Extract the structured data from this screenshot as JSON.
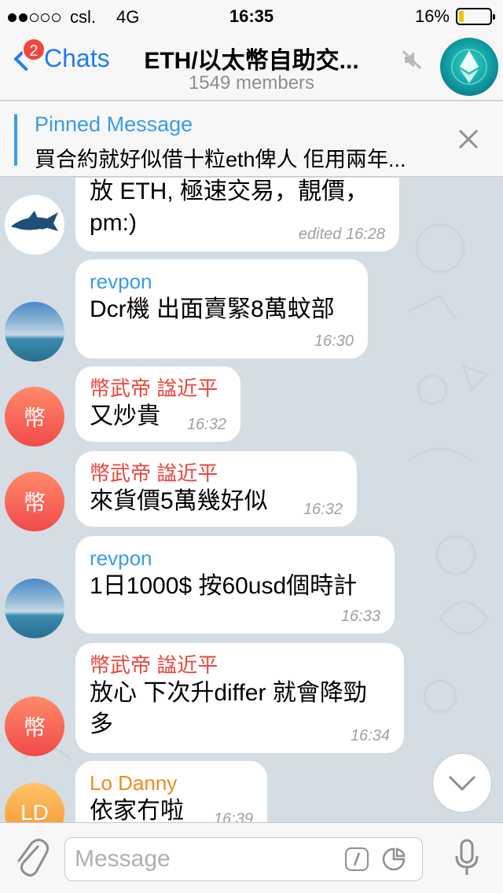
{
  "status": {
    "carrier": "csl.",
    "network": "4G",
    "time": "16:35",
    "battery": "16%",
    "signal_bars": 2,
    "battery_fraction": 0.16
  },
  "nav": {
    "back_label": "Chats",
    "badge": "2",
    "title": "ETH/以太幣自助交...",
    "subtitle": "1549 members",
    "icons": {
      "back": "chevron-left-icon",
      "mute": "muted-speaker-icon"
    }
  },
  "pinned": {
    "title": "Pinned Message",
    "text": "買合約就好似借十粒eth俾人 佢用兩年..."
  },
  "messages": [
    {
      "sender": "",
      "avatar": "",
      "text": "放 ETH, 極速交易，靚價，\npm:)",
      "time": "edited 16:28"
    },
    {
      "sender": "revpon",
      "avatar": "",
      "text": "Dcr機 出面賣緊8萬蚊部",
      "time": "16:30"
    },
    {
      "sender": "幣武帝 諡近平",
      "avatar": "幣",
      "text": "又炒貴",
      "time": "16:32"
    },
    {
      "sender": "幣武帝 諡近平",
      "avatar": "幣",
      "text": "來貨價5萬幾好似",
      "time": "16:32"
    },
    {
      "sender": "revpon",
      "avatar": "",
      "text": "1日1000$ 按60usd個時計",
      "time": "16:33"
    },
    {
      "sender": "幣武帝 諡近平",
      "avatar": "幣",
      "text": "放心 下次升differ 就會降勁\n多",
      "time": "16:34"
    },
    {
      "sender": "Lo Danny",
      "avatar": "LD",
      "text": "依家冇啦",
      "time": "16:39"
    }
  ],
  "input": {
    "placeholder": "Message"
  },
  "colors": {
    "accent": "#1f7df2",
    "pinned_accent": "#3b9be8",
    "badge": "#f2453d",
    "name_red": "#e8463c",
    "name_orange": "#f08a1e",
    "chat_bg": "#d4dde3"
  }
}
